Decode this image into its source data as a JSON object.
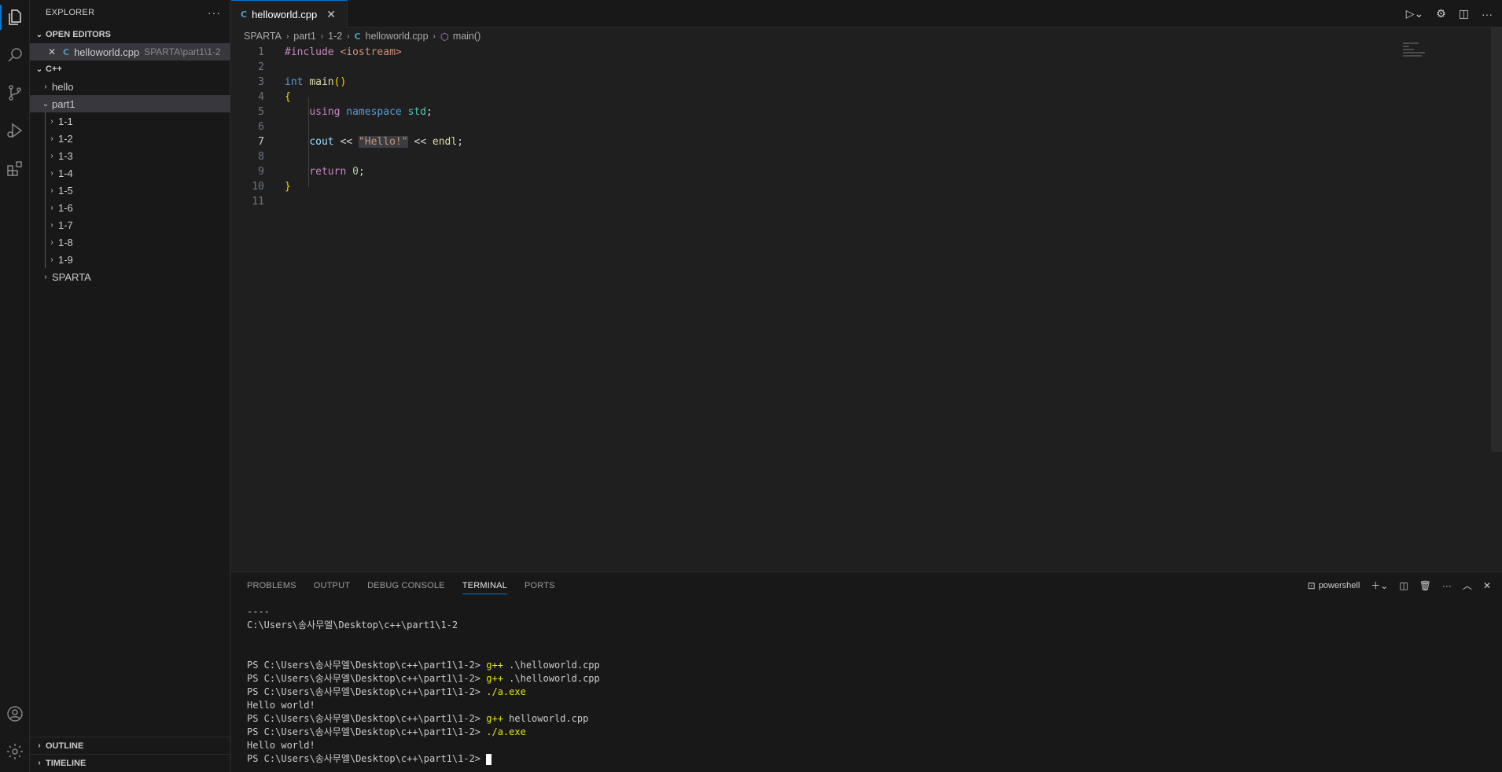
{
  "sidebar": {
    "title": "EXPLORER",
    "more": "···",
    "open_editors_label": "OPEN EDITORS",
    "open_editor": {
      "name": "helloworld.cpp",
      "path": "SPARTA\\part1\\1-2"
    },
    "folder_label": "C++",
    "tree": [
      {
        "label": "hello"
      },
      {
        "label": "part1"
      },
      {
        "label": "1-1"
      },
      {
        "label": "1-2"
      },
      {
        "label": "1-3"
      },
      {
        "label": "1-4"
      },
      {
        "label": "1-5"
      },
      {
        "label": "1-6"
      },
      {
        "label": "1-7"
      },
      {
        "label": "1-8"
      },
      {
        "label": "1-9"
      },
      {
        "label": "SPARTA"
      }
    ],
    "outline_label": "OUTLINE",
    "timeline_label": "TIMELINE"
  },
  "tab": {
    "name": "helloworld.cpp",
    "icon": "C"
  },
  "breadcrumb": {
    "items": [
      "SPARTA",
      "part1",
      "1-2",
      "helloworld.cpp",
      "main()"
    ]
  },
  "editor": {
    "line_numbers": [
      "1",
      "2",
      "3",
      "4",
      "5",
      "6",
      "7",
      "8",
      "9",
      "10",
      "11"
    ],
    "current_line": 7,
    "lines": {
      "l1_dir": "#include",
      "l1_inc": "<iostream>",
      "l3_kw": "int",
      "l3_fn": "main",
      "l3_paren": "()",
      "l4_brace": "{",
      "l5_using": "using",
      "l5_namespace": "namespace",
      "l5_std": "std",
      "l5_semi": ";",
      "l7_cout": "cout",
      "l7_op1": "<<",
      "l7_str": "\"Hello!\"",
      "l7_op2": "<<",
      "l7_endl": "endl",
      "l7_semi": ";",
      "l9_return": "return",
      "l9_zero": "0",
      "l9_semi": ";",
      "l10_brace": "}"
    }
  },
  "panel": {
    "tabs": [
      "PROBLEMS",
      "OUTPUT",
      "DEBUG CONSOLE",
      "TERMINAL",
      "PORTS"
    ],
    "active_tab": "TERMINAL",
    "shell": "powershell",
    "terminal": {
      "dashes": "----",
      "path_line": "C:\\Users\\송사무엘\\Desktop\\c++\\part1\\1-2",
      "prompt": "PS C:\\Users\\송사무엘\\Desktop\\c++\\part1\\1-2> ",
      "cmd1_a": "g++",
      "cmd1_b": " .\\helloworld.cpp",
      "cmd2_a": "g++",
      "cmd2_b": " .\\helloworld.cpp",
      "cmd3": "./a.exe",
      "out1": "Hello world!",
      "cmd4_a": "g++",
      "cmd4_b": " helloworld.cpp",
      "cmd5": "./a.exe",
      "out2": "Hello world!"
    }
  },
  "colors": {
    "accent": "#0078d4",
    "background": "#1f1f1f",
    "sidebar": "#181818"
  }
}
